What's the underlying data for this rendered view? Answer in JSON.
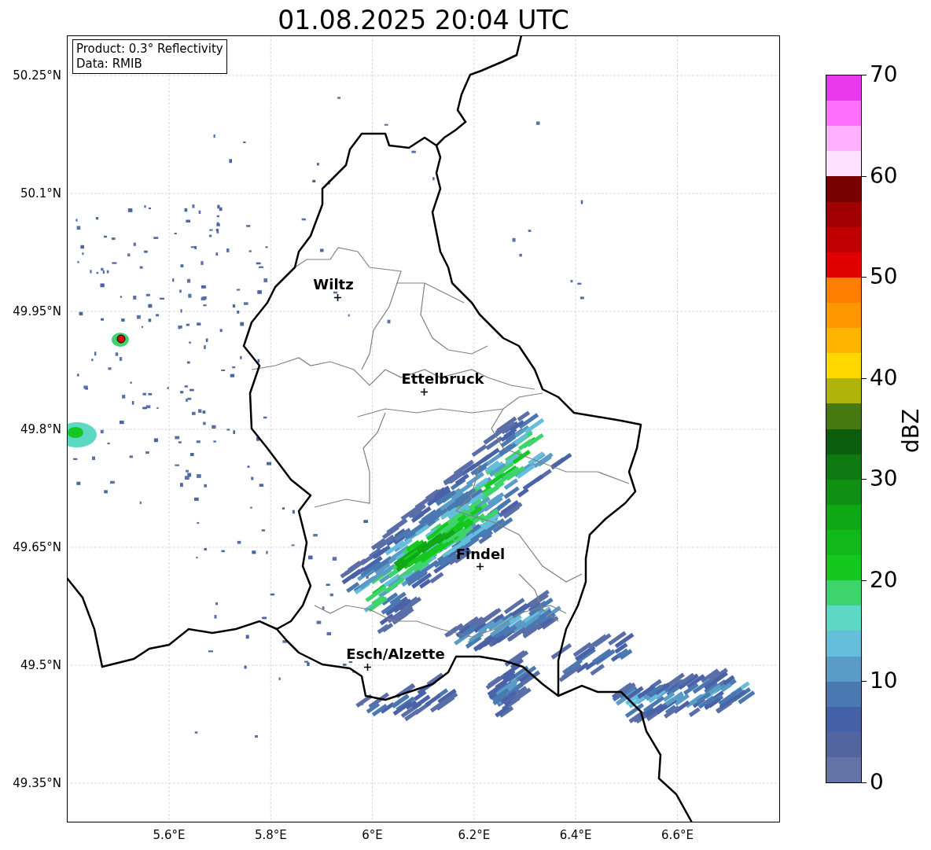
{
  "title": "01.08.2025 20:04 UTC",
  "info_box": [
    "Product: 0.3° Reflectivity",
    "Data: RMIB"
  ],
  "cities": [
    "Wiltz",
    "Ettelbruck",
    "Findel",
    "Esch/Alzette"
  ],
  "lat_ticks": [
    "50.25°N",
    "50.1°N",
    "49.95°N",
    "49.8°N",
    "49.65°N",
    "49.5°N",
    "49.35°N"
  ],
  "lon_ticks": [
    "5.6°E",
    "5.8°E",
    "6°E",
    "6.2°E",
    "6.4°E",
    "6.6°E"
  ],
  "colorbar": {
    "label": "dBZ",
    "ticks": [
      "70",
      "60",
      "50",
      "40",
      "30",
      "20",
      "10",
      "0"
    ],
    "segments": [
      {
        "color": "#e838ec"
      },
      {
        "color": "#ff70ff"
      },
      {
        "color": "#ffb0ff"
      },
      {
        "color": "#ffe0ff"
      },
      {
        "color": "#780000"
      },
      {
        "color": "#a00000"
      },
      {
        "color": "#c00000"
      },
      {
        "color": "#e00000"
      },
      {
        "color": "#ff7e00"
      },
      {
        "color": "#ff9800"
      },
      {
        "color": "#ffb400"
      },
      {
        "color": "#ffd800"
      },
      {
        "color": "#b0b40a"
      },
      {
        "color": "#467a10"
      },
      {
        "color": "#0a5e0e"
      },
      {
        "color": "#0c7a10"
      },
      {
        "color": "#0e9012"
      },
      {
        "color": "#10a814"
      },
      {
        "color": "#12b81a"
      },
      {
        "color": "#14c81e"
      },
      {
        "color": "#3ed46c"
      },
      {
        "color": "#5cd8c4"
      },
      {
        "color": "#64bedc"
      },
      {
        "color": "#5a9cc8"
      },
      {
        "color": "#4a78b0"
      },
      {
        "color": "#4460a8"
      },
      {
        "color": "#52659e"
      },
      {
        "color": "#6473a6"
      }
    ]
  }
}
